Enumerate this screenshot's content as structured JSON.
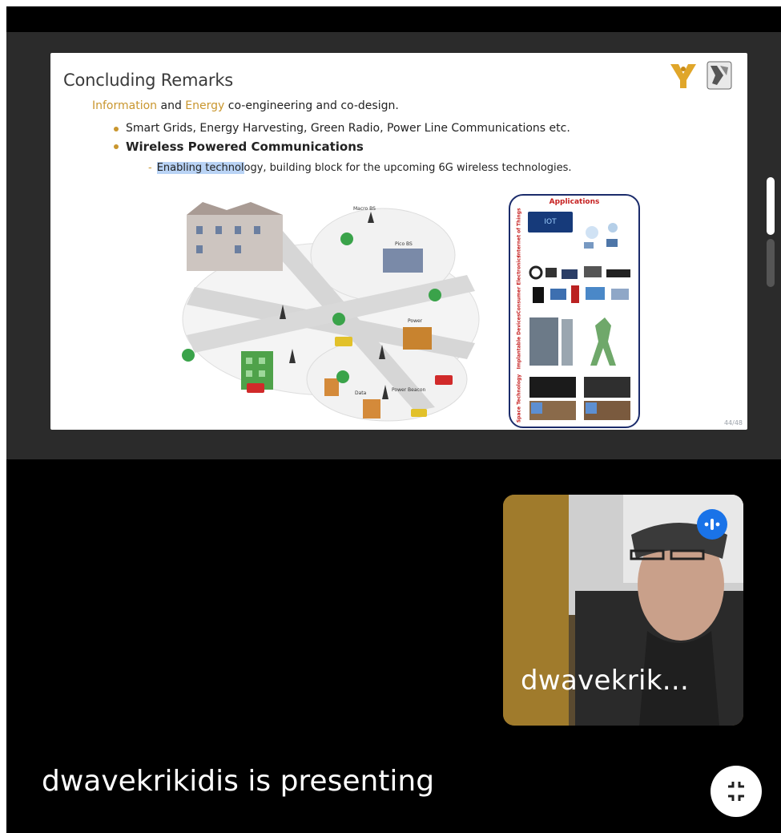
{
  "slide": {
    "title": "Concluding Remarks",
    "line1": {
      "word1": "Information",
      "and": " and ",
      "word2": "Energy",
      "rest": " co-engineering and co-design."
    },
    "bullets": [
      "Smart Grids, Energy Harvesting, Green Radio, Power Line Communications etc.",
      "Wireless Powered Communications"
    ],
    "sub_bullet": {
      "highlighted": "Enabling technol",
      "rest": "ogy, building block for the upcoming 6G wireless technologies."
    },
    "diagram_labels": {
      "macro": "Macro BS",
      "pico": "Pico BS",
      "power": "Power",
      "data": "Data",
      "power_beacon": "Power Beacon"
    },
    "applications": {
      "title": "Applications",
      "iot_label": "IOT",
      "rows": [
        "Internet of Things",
        "Consumer Electronics",
        "Implantable Devices",
        "Space Technology"
      ]
    },
    "page_number": "44/48"
  },
  "participant": {
    "name": "dwavekrik..."
  },
  "status": {
    "presenting_text": "dwavekrikidis is presenting"
  },
  "colors": {
    "accent_gold": "#c9962e",
    "highlight": "#b9d3f5",
    "speaking": "#1a73e8",
    "apps_border": "#1b2c6b",
    "apps_title": "#c62020"
  },
  "icons": {
    "speaking": "audio-wave-icon",
    "exit": "exit-fullscreen-icon"
  }
}
